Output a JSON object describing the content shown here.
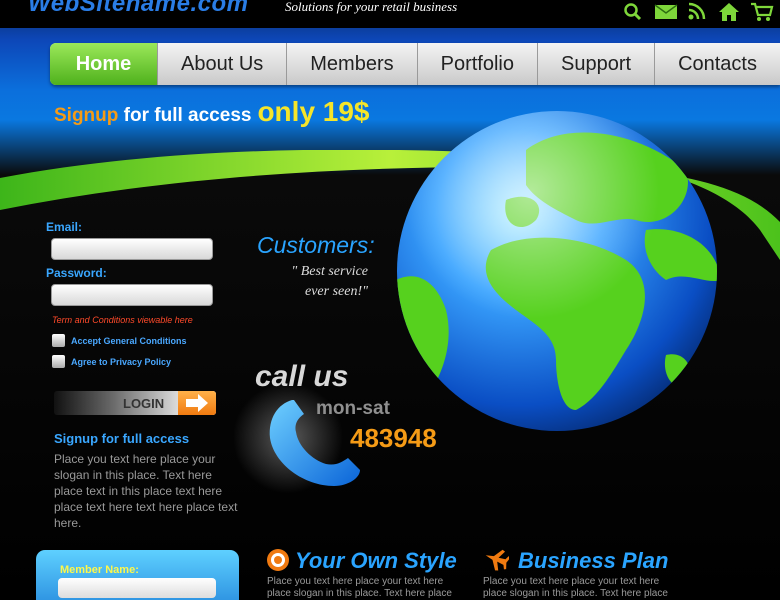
{
  "header": {
    "logo": "WebSitename.com",
    "tagline": "Solutions for your retail business",
    "icons": [
      "search-icon",
      "mail-icon",
      "rss-icon",
      "home-icon",
      "cart-icon"
    ]
  },
  "nav": {
    "tabs": [
      "Home",
      "About Us",
      "Members",
      "Portfolio",
      "Support",
      "Contacts"
    ],
    "active": "Home"
  },
  "promo": {
    "signup_word": "Signup",
    "rest": " for full access",
    "price": "only 19$"
  },
  "login_form": {
    "email_label": "Email:",
    "password_label": "Password:",
    "terms_note": "Term and Conditions viewable here",
    "checkbox1": "Accept General Conditions",
    "checkbox2": "Agree to Privacy Policy",
    "login_button": "LOGIN"
  },
  "signup_section": {
    "title": "Signup for full access",
    "text": "Place you text here place your slogan in this place. Text here place text in this place text here place text here text here place text here."
  },
  "member": {
    "label": "Member Name:"
  },
  "customers": {
    "title": "Customers:",
    "quote": "\" Best service ever seen!\""
  },
  "contact": {
    "call": "call us",
    "days": "mon-sat",
    "number": "483948"
  },
  "features": [
    {
      "title": "Your Own Style",
      "icon": "target-icon",
      "text": "Place you text here place your text here place slogan in this place. Text here place text sample"
    },
    {
      "title": "Business Plan",
      "icon": "airplane-icon",
      "text": "Place you text here place your text here place slogan in this place. Text here place text sample"
    }
  ],
  "colors": {
    "accent_blue": "#2aa4ff",
    "accent_orange": "#f59b16",
    "accent_yellow": "#f5e52a",
    "home_green": "#4fb11c"
  }
}
